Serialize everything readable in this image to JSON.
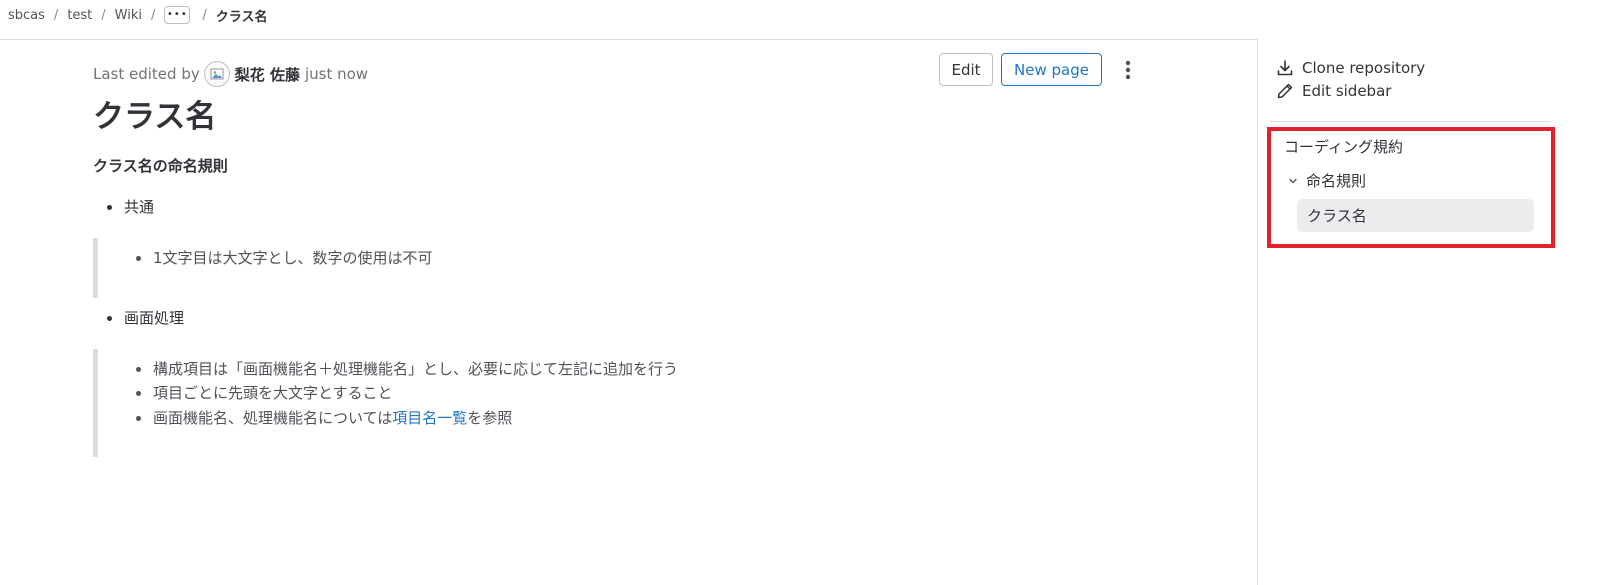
{
  "breadcrumb": {
    "items": [
      "sbcas",
      "test",
      "Wiki"
    ],
    "ellipsis": "•••",
    "current": "クラス名"
  },
  "meta": {
    "prefix": "Last edited by",
    "author": "梨花 佐藤",
    "time": "just now"
  },
  "actions": {
    "edit_label": "Edit",
    "new_page_label": "New page"
  },
  "page": {
    "title": "クラス名",
    "heading": "クラス名の命名規則",
    "sections": [
      {
        "label": "共通",
        "items": [
          "1文字目は大文字とし、数字の使用は不可"
        ]
      },
      {
        "label": "画面処理",
        "items": [
          "構成項目は「画面機能名＋処理機能名」とし、必要に応じて左記に追加を行う",
          "項目ごとに先頭を大文字とすること"
        ],
        "link_item": {
          "before": "画面機能名、処理機能名については",
          "link": "項目名一覧",
          "after": "を参照"
        }
      }
    ]
  },
  "sidebar": {
    "clone_label": "Clone repository",
    "edit_label": "Edit sidebar",
    "nav": {
      "root": "コーディング規約",
      "group": "命名規則",
      "active": "クラス名"
    }
  },
  "colors": {
    "link": "#1f75cb",
    "highlight_border": "#e3212b",
    "active_bg": "#ececef"
  }
}
